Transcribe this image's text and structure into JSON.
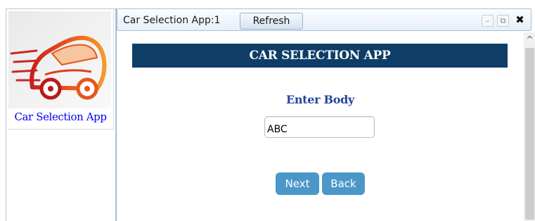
{
  "launcher": {
    "app_tile": {
      "label": "Car Selection App",
      "icon": "car-logo-icon"
    }
  },
  "window": {
    "title": "Car Selection App:1",
    "refresh_label": "Refresh",
    "controls": {
      "minimize": "–",
      "popout": "⧉",
      "close": "✖"
    }
  },
  "form": {
    "header": "CAR SELECTION APP",
    "field_label": "Enter Body",
    "body_value": "ABC",
    "next_label": "Next",
    "back_label": "Back"
  },
  "colors": {
    "header_bg": "#0e3e67",
    "label_color": "#23479a",
    "button_bg": "#4b98c8",
    "link_color": "#0000ee"
  }
}
